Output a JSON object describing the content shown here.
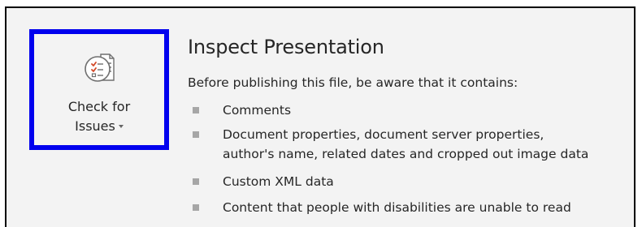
{
  "check_for_issues": {
    "line1": "Check for",
    "line2": "Issues",
    "icon": "document-checklist-icon"
  },
  "inspect": {
    "title": "Inspect Presentation",
    "subtitle": "Before publishing this file, be aware that it contains:",
    "items": [
      {
        "lines": [
          "Comments"
        ]
      },
      {
        "lines": [
          "Document properties, document server properties,",
          "author's name, related dates and cropped out image data"
        ]
      },
      {
        "lines": [
          "Custom XML data"
        ]
      },
      {
        "lines": [
          "Content that people with disabilities are unable to read"
        ]
      }
    ]
  },
  "colors": {
    "highlight_border": "#0000ee",
    "panel_background": "#f3f3f3",
    "bullet": "#a6a6a6"
  }
}
